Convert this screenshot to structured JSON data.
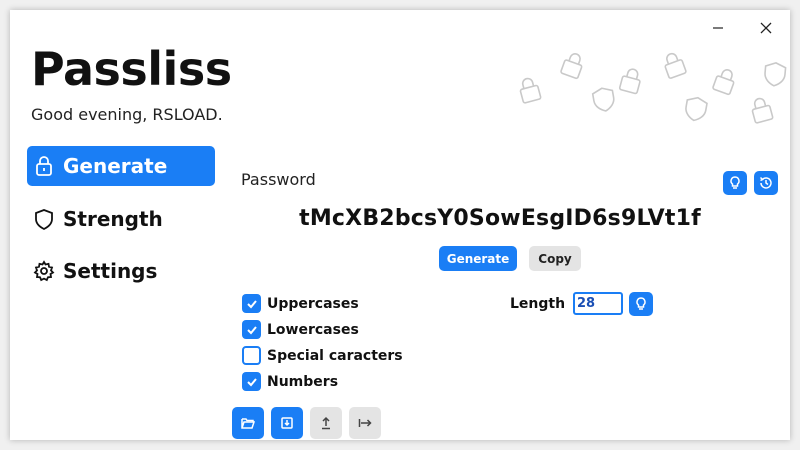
{
  "window": {
    "controls": {
      "minimize_icon": "minimize-icon",
      "close_icon": "close-icon"
    }
  },
  "app": {
    "title": "Passliss",
    "greeting": "Good evening, RSLOAD."
  },
  "sidebar": {
    "items": [
      {
        "label": "Generate",
        "icon": "lock-icon",
        "active": true
      },
      {
        "label": "Strength",
        "icon": "shield-icon",
        "active": false
      },
      {
        "label": "Settings",
        "icon": "gear-icon",
        "active": false
      }
    ]
  },
  "main": {
    "section_label": "Password",
    "password": "tMcXB2bcsY0SowEsgID6s9LVt1f",
    "generate_label": "Generate",
    "copy_label": "Copy",
    "options": [
      {
        "label": "Uppercases",
        "checked": true
      },
      {
        "label": "Lowercases",
        "checked": true
      },
      {
        "label": "Special caracters",
        "checked": false
      },
      {
        "label": "Numbers",
        "checked": true
      }
    ],
    "length_label": "Length",
    "length_value": "28"
  },
  "colors": {
    "accent": "#1a7ef5",
    "secondary_button": "#e4e4e4",
    "decoration": "#c9c9c9"
  }
}
